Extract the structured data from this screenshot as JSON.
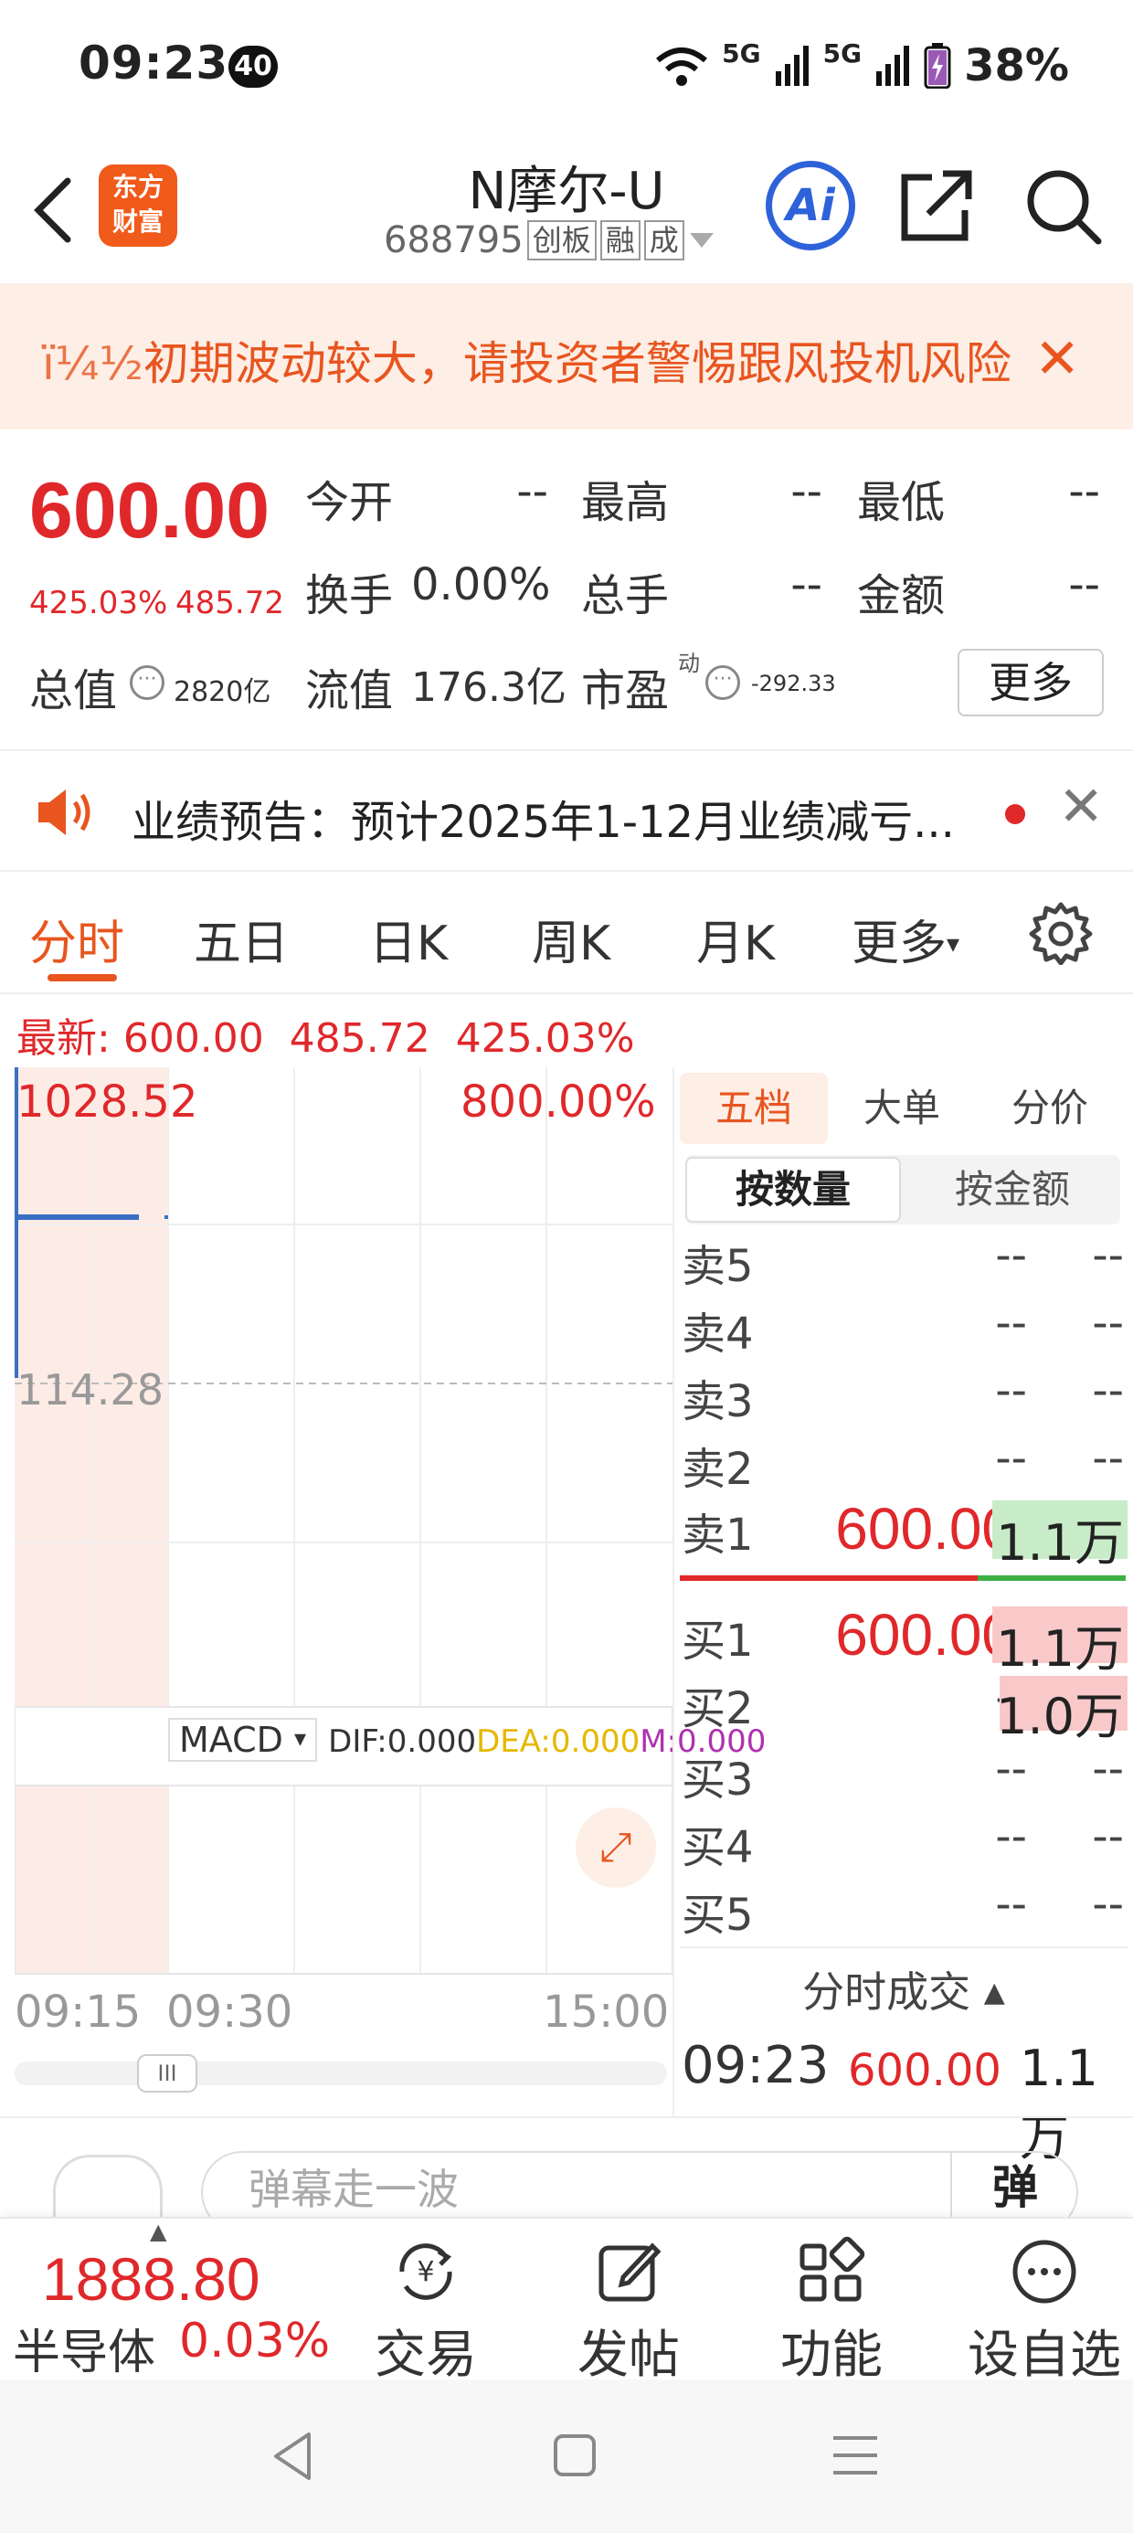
{
  "status": {
    "time": "09:23",
    "badge": "40",
    "battery": "38%",
    "net1": "5G",
    "net2": "5G"
  },
  "header": {
    "logo_line1": "东方",
    "logo_line2": "财富",
    "name": "N摩尔-U",
    "code": "688795",
    "tags": [
      "创板",
      "融",
      "成"
    ],
    "ai_label": "Ai"
  },
  "warning": {
    "text": "初期波动较大，请投资者警惕跟风投机风险",
    "lead": "ï¼½",
    "close": "✕"
  },
  "quote": {
    "price": "600.00",
    "pct": "425.03%",
    "change": "485.72",
    "open_label": "今开",
    "open": "--",
    "high_label": "最高",
    "high": "--",
    "low_label": "最低",
    "low": "--",
    "turnover_label": "换手",
    "turnover": "0.00%",
    "volume_label": "总手",
    "volume": "--",
    "amount_label": "金额",
    "amount": "--",
    "mktcap_label": "总值",
    "mktcap": "2820亿",
    "float_label": "流值",
    "float": "176.3亿",
    "pe_label": "市盈",
    "pe_sup": "动",
    "pe": "-292.33",
    "more": "更多"
  },
  "announce": {
    "text": "业绩预告：预计2025年1-12月业绩减亏...",
    "close": "✕"
  },
  "tabs": [
    "分时",
    "五日",
    "日K",
    "周K",
    "月K",
    "更多"
  ],
  "latest": {
    "label": "最新:",
    "price": "600.00",
    "change": "485.72",
    "pct": "425.03%"
  },
  "chart": {
    "price_top": "1028.52",
    "pct_top": "800.00%",
    "price_mid": "114.28",
    "macd_label": "MACD",
    "dif": "DIF:0.000",
    "dea": "DEA:0.000",
    "m": "M:0.000",
    "times": [
      "09:15",
      "09:30",
      "15:00"
    ],
    "scroll_thumb": "III"
  },
  "chart_data": {
    "type": "line",
    "series": [
      {
        "values": [
          600.0,
          600.0
        ]
      }
    ],
    "ylabel_top": "1028.52",
    "ylabel_mid": "114.28",
    "x_labels": [
      "09:15",
      "09:30",
      "15:00"
    ]
  },
  "orderbook": {
    "tabs": [
      "五档",
      "大单",
      "分价"
    ],
    "seg": [
      "按数量",
      "按金额"
    ],
    "sell": [
      {
        "label": "卖5",
        "price": "--",
        "vol": "--"
      },
      {
        "label": "卖4",
        "price": "--",
        "vol": "--"
      },
      {
        "label": "卖3",
        "price": "--",
        "vol": "--"
      },
      {
        "label": "卖2",
        "price": "--",
        "vol": "--"
      },
      {
        "label": "卖1",
        "price": "600.00",
        "vol": "1.1万"
      }
    ],
    "buy": [
      {
        "label": "买1",
        "price": "600.00",
        "vol": "1.1万"
      },
      {
        "label": "买2",
        "price": "--",
        "vol": "1.0万"
      },
      {
        "label": "买3",
        "price": "--",
        "vol": "--"
      },
      {
        "label": "买4",
        "price": "--",
        "vol": "--"
      },
      {
        "label": "买5",
        "price": "--",
        "vol": "--"
      }
    ],
    "trade_head": "分时成交",
    "trade_time": "09:23",
    "trade_price": "600.00",
    "trade_vol": "1.1万"
  },
  "comment": {
    "placeholder": "弹幕走一波",
    "danmu": "弹"
  },
  "bottom_nav": {
    "index_value": "1888.80",
    "index_name": "半导体",
    "index_pct": "0.03%",
    "items": [
      "交易",
      "发帖",
      "功能",
      "设自选"
    ]
  }
}
